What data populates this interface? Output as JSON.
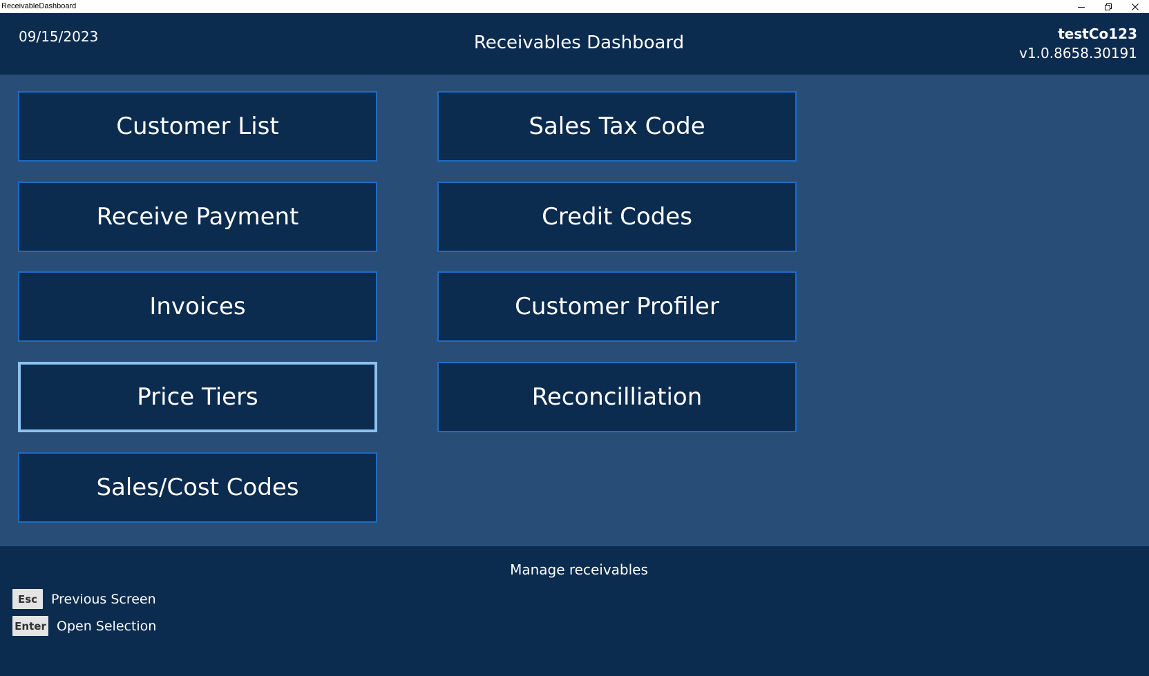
{
  "window": {
    "title": "ReceivableDashboard"
  },
  "header": {
    "date": "09/15/2023",
    "title": "Receivables Dashboard",
    "company": "testCo123",
    "version": "v1.0.8658.30191"
  },
  "menu": {
    "customer_list": "Customer List",
    "receive_payment": "Receive Payment",
    "invoices": "Invoices",
    "price_tiers": "Price Tiers",
    "sales_cost_codes": "Sales/Cost Codes",
    "sales_tax_code": "Sales Tax Code",
    "credit_codes": "Credit Codes",
    "customer_profiler": "Customer Profiler",
    "reconcilliation": "Reconcilliation",
    "selected": "Price Tiers"
  },
  "footer": {
    "hint": "Manage receivables",
    "shortcuts": [
      {
        "key": "Esc",
        "label": "Previous Screen"
      },
      {
        "key": "Enter",
        "label": "Open Selection"
      }
    ]
  },
  "colors": {
    "header_bg": "#0b2b4f",
    "main_bg": "#284e78",
    "tile_bg": "#0b2b4f",
    "tile_border": "#1f6bc4",
    "selected_border": "#8cc2f2",
    "key_bg": "#e4e4e4"
  },
  "icons": {
    "minimize": "minimize-icon",
    "restore": "restore-icon",
    "close": "close-icon"
  }
}
